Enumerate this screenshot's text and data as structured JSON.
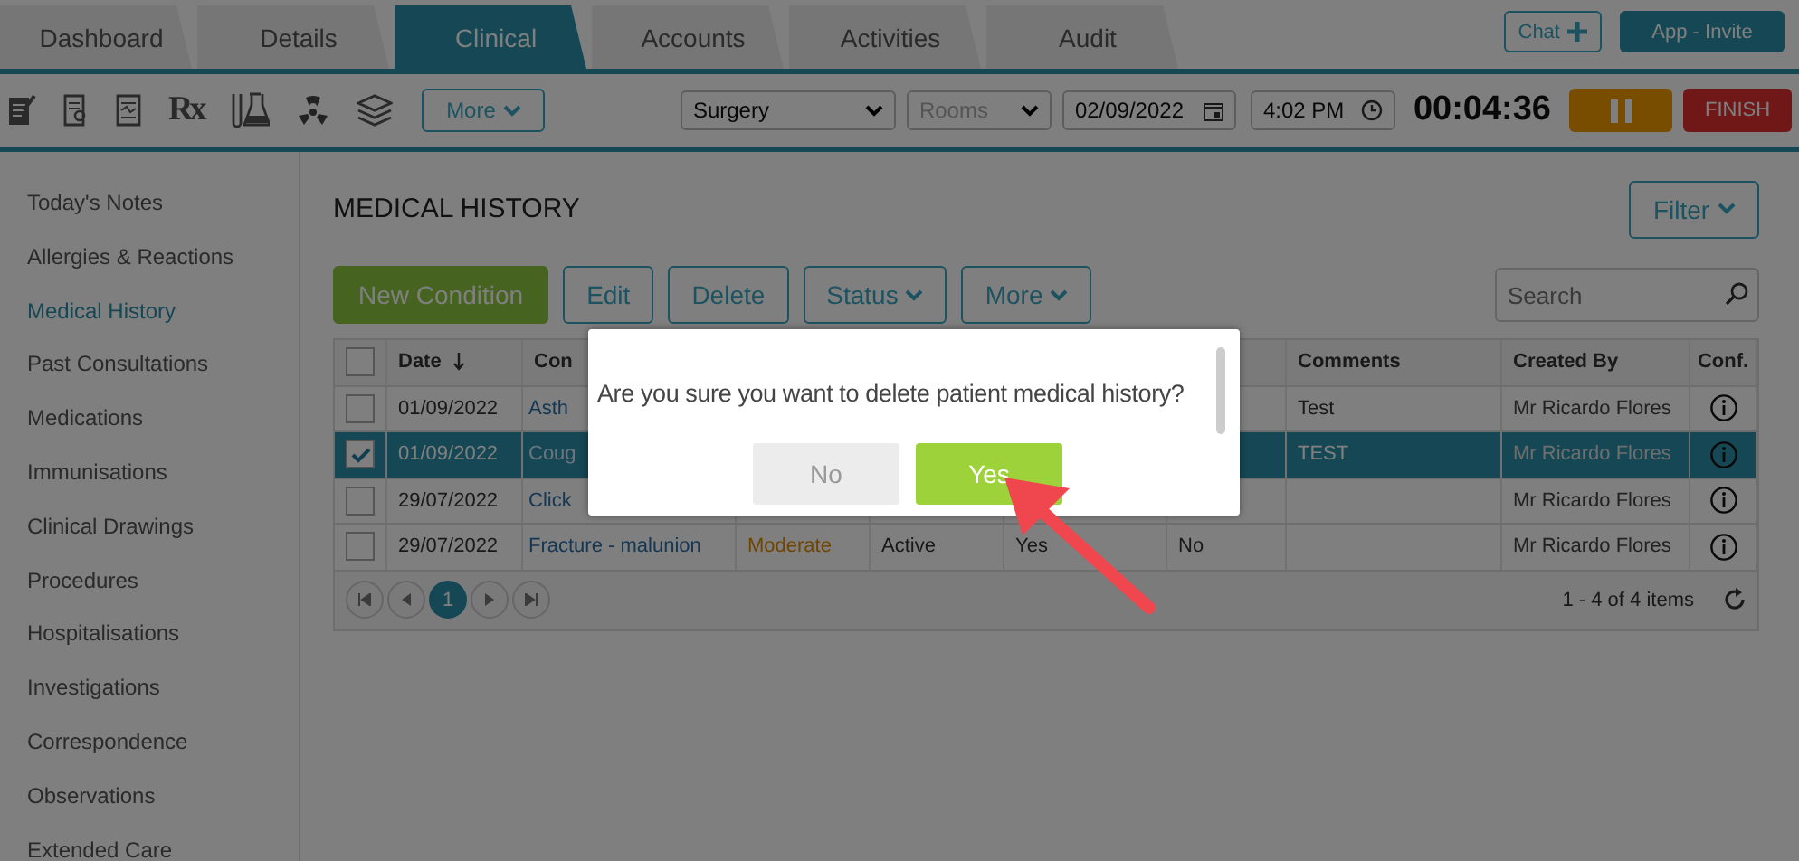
{
  "tabs": [
    {
      "label": "Dashboard",
      "selected": false
    },
    {
      "label": "Details",
      "selected": false
    },
    {
      "label": "Clinical",
      "selected": true
    },
    {
      "label": "Accounts",
      "selected": false
    },
    {
      "label": "Activities",
      "selected": false
    },
    {
      "label": "Audit",
      "selected": false
    }
  ],
  "header_buttons": {
    "chat": "Chat",
    "invite": "App - Invite"
  },
  "toolbar": {
    "rx": "Rx",
    "more": "More",
    "location": "Surgery",
    "rooms_placeholder": "Rooms",
    "date": "02/09/2022",
    "time": "4:02 PM",
    "timer": "00:04:36",
    "finish": "FINISH"
  },
  "sidebar": {
    "items": [
      {
        "label": "Today's Notes",
        "selected": false
      },
      {
        "label": "Allergies & Reactions",
        "selected": false
      },
      {
        "label": "Medical History",
        "selected": true
      },
      {
        "label": "Past Consultations",
        "selected": false
      },
      {
        "label": "Medications",
        "selected": false
      },
      {
        "label": "Immunisations",
        "selected": false
      },
      {
        "label": "Clinical Drawings",
        "selected": false
      },
      {
        "label": "Procedures",
        "selected": false
      },
      {
        "label": "Hospitalisations",
        "selected": false
      },
      {
        "label": "Investigations",
        "selected": false
      },
      {
        "label": "Correspondence",
        "selected": false
      },
      {
        "label": "Observations",
        "selected": false
      },
      {
        "label": "Extended Care",
        "selected": false
      }
    ]
  },
  "page_title": "MEDICAL HISTORY",
  "filter": "Filter",
  "actions": [
    {
      "label": "New Condition",
      "kind": "primary"
    },
    {
      "label": "Edit",
      "kind": "plain"
    },
    {
      "label": "Delete",
      "kind": "plain"
    },
    {
      "label": "Status",
      "kind": "menu"
    },
    {
      "label": "More",
      "kind": "menu"
    }
  ],
  "search": {
    "placeholder": "Search"
  },
  "table": {
    "all_checked": false,
    "columns": [
      "Date",
      "Con",
      "Comments",
      "Created By",
      "Conf."
    ],
    "rows": [
      {
        "checked": false,
        "selected": false,
        "date": "01/09/2022",
        "condition": "Asth",
        "comments": "Test",
        "created_by": "Mr Ricardo Flores"
      },
      {
        "checked": true,
        "selected": true,
        "date": "01/09/2022",
        "condition": "Coug",
        "comments": "TEST",
        "created_by": "Mr Ricardo Flores"
      },
      {
        "checked": false,
        "selected": false,
        "date": "29/07/2022",
        "condition": "Click",
        "created_by": "Mr Ricardo Flores"
      },
      {
        "checked": false,
        "selected": false,
        "date": "29/07/2022",
        "condition": "Fracture - malunion",
        "column_4": "Moderate",
        "column_5": "Active",
        "column_6": "Yes",
        "column_7": "No",
        "created_by": "Mr Ricardo Flores"
      }
    ]
  },
  "pager": {
    "pages": [
      {
        "label": "1",
        "selected": true
      }
    ],
    "summary": "1 - 4 of 4 items"
  },
  "dialog": {
    "message": "Are you sure you want to delete patient medical history?",
    "buttons": [
      {
        "label": "No",
        "kind": "secondary"
      },
      {
        "label": "Yes",
        "kind": "confirm"
      }
    ]
  }
}
